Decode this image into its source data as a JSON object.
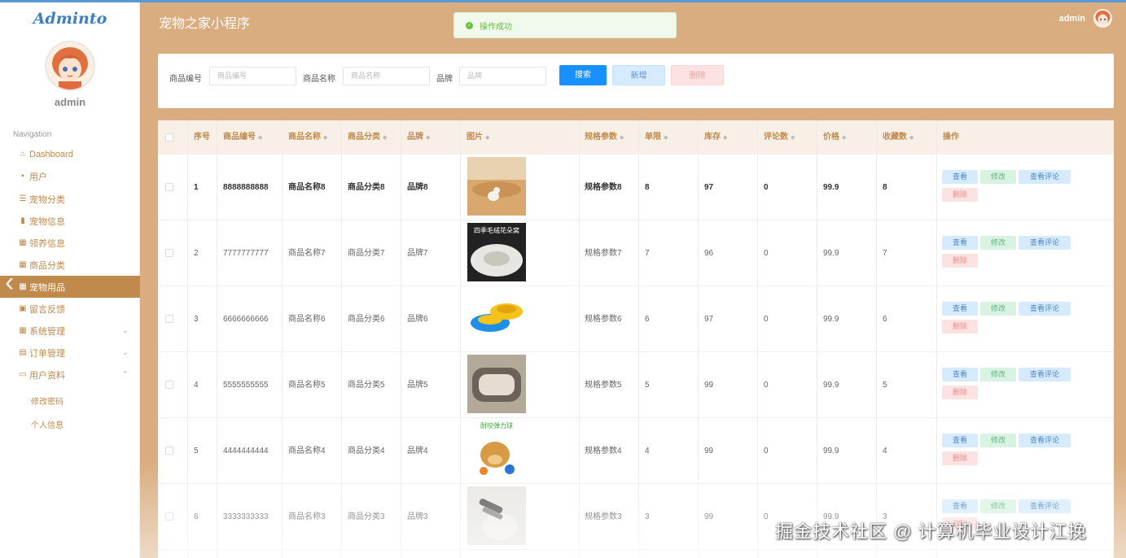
{
  "sidebar": {
    "logo": "Adminto",
    "user": "admin",
    "nav_title": "Navigation",
    "items": [
      {
        "label": "Dashboard",
        "icon": "home-icon"
      },
      {
        "label": "用户",
        "icon": "chat-icon"
      },
      {
        "label": "宠物分类",
        "icon": "list-icon"
      },
      {
        "label": "宠物信息",
        "icon": "bar-chart-icon"
      },
      {
        "label": "领养信息",
        "icon": "grid-icon"
      },
      {
        "label": "商品分类",
        "icon": "grid-icon"
      },
      {
        "label": "宠物用品",
        "icon": "grid-icon"
      },
      {
        "label": "留言反馈",
        "icon": "briefcase-icon"
      },
      {
        "label": "系统管理",
        "icon": "grid-icon"
      },
      {
        "label": "订单管理",
        "icon": "box-icon"
      },
      {
        "label": "用户资料",
        "icon": "calendar-icon"
      }
    ],
    "sub_items": [
      "修改密码",
      "个人信息"
    ],
    "active_color": "#c08a4d"
  },
  "header": {
    "title": "宠物之家小程序",
    "toast": "操作成功",
    "user": "admin"
  },
  "search": {
    "label_code": "商品编号",
    "placeholder_code": "商品编号",
    "label_name": "商品名称",
    "placeholder_name": "商品名称",
    "label_brand": "品牌",
    "placeholder_brand": "品牌",
    "btn_search": "搜索",
    "btn_add": "新增",
    "btn_delete": "删除"
  },
  "table": {
    "headers": [
      "序号",
      "商品编号",
      "商品名称",
      "商品分类",
      "品牌",
      "图片",
      "规格参数",
      "单限",
      "库存",
      "评论数",
      "价格",
      "收藏数",
      "操作"
    ],
    "actions": {
      "view": "查看",
      "edit": "修改",
      "review": "查看评论",
      "delete": "删除"
    },
    "rows": [
      {
        "no": "1",
        "code": "8888888888",
        "name": "商品名称8",
        "category": "商品分类8",
        "brand": "品牌8",
        "spec": "规格参数8",
        "limit": "8",
        "stock": "97",
        "comments": "0",
        "price": "99.9",
        "favs": "8"
      },
      {
        "no": "2",
        "code": "7777777777",
        "name": "商品名称7",
        "category": "商品分类7",
        "brand": "品牌7",
        "spec": "规格参数7",
        "limit": "7",
        "stock": "96",
        "comments": "0",
        "price": "99.9",
        "favs": "7"
      },
      {
        "no": "3",
        "code": "6666666666",
        "name": "商品名称6",
        "category": "商品分类6",
        "brand": "品牌6",
        "spec": "规格参数6",
        "limit": "6",
        "stock": "97",
        "comments": "0",
        "price": "99.9",
        "favs": "6"
      },
      {
        "no": "4",
        "code": "5555555555",
        "name": "商品名称5",
        "category": "商品分类5",
        "brand": "品牌5",
        "spec": "规格参数5",
        "limit": "5",
        "stock": "99",
        "comments": "0",
        "price": "99.9",
        "favs": "5"
      },
      {
        "no": "5",
        "code": "4444444444",
        "name": "商品名称4",
        "category": "商品分类4",
        "brand": "品牌4",
        "spec": "规格参数4",
        "limit": "4",
        "stock": "99",
        "comments": "0",
        "price": "99.9",
        "favs": "4"
      },
      {
        "no": "6",
        "code": "3333333333",
        "name": "商品名称3",
        "category": "商品分类3",
        "brand": "品牌3",
        "spec": "规格参数3",
        "limit": "3",
        "stock": "99",
        "comments": "0",
        "price": "99.9",
        "favs": "3"
      }
    ],
    "image_captions": {
      "row2": "四季毛绒花朵窝",
      "row5": "耐咬弹力球"
    }
  },
  "watermark": "掘金技术社区 @ 计算机毕业设计江挽"
}
